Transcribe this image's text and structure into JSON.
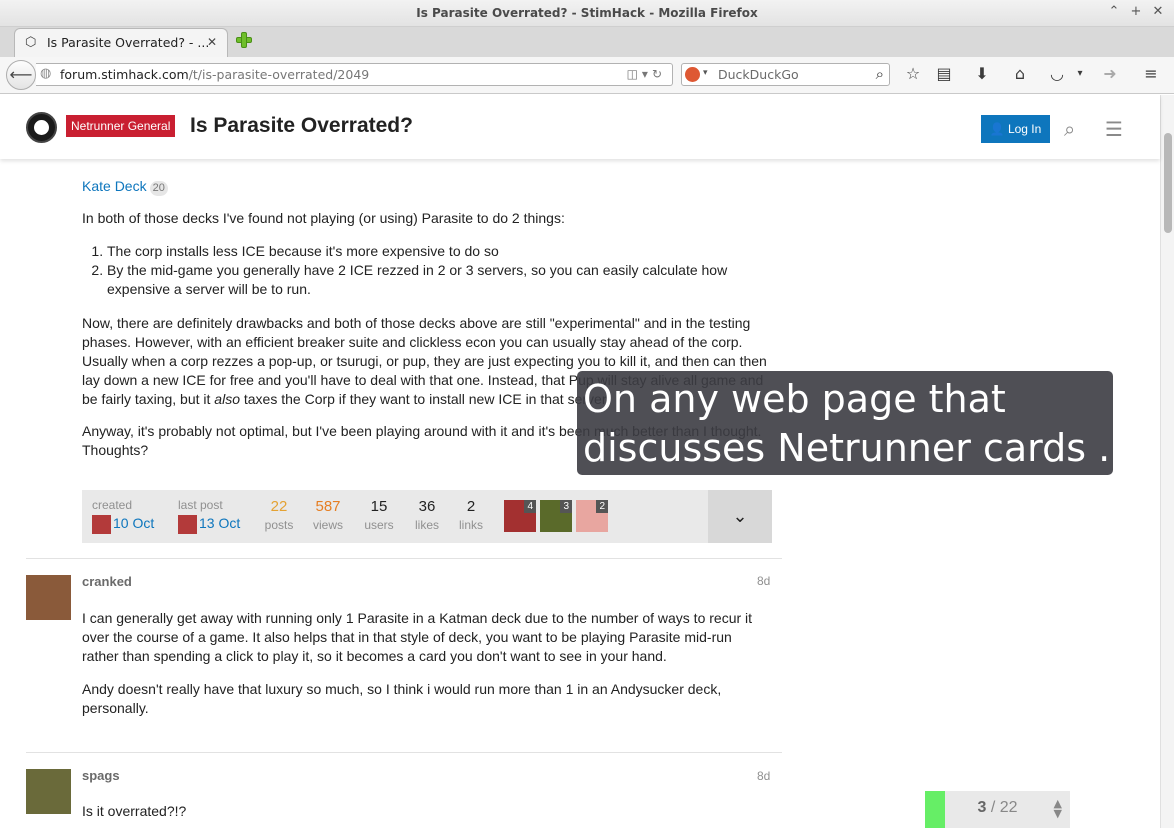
{
  "window": {
    "title": "Is Parasite Overrated? - StimHack - Mozilla Firefox"
  },
  "tab": {
    "label": "Is Parasite Overrated? - ..."
  },
  "urlbar": {
    "host": "forum.stimhack.com",
    "path": "/t/is-parasite-overrated/2049"
  },
  "search": {
    "placeholder": "DuckDuckGo"
  },
  "header": {
    "category": "Netrunner General",
    "topic_title": "Is Parasite Overrated?",
    "login_label": "Log In"
  },
  "post1": {
    "link_text": "Kate Deck",
    "link_count": "20",
    "intro": "In both of those decks I've found not playing (or using) Parasite to do 2 things:",
    "list": [
      "The corp installs less ICE because it's more expensive to do so",
      "By the mid-game you generally have 2 ICE rezzed in 2 or 3 servers, so you can easily calculate how expensive a server will be to run."
    ],
    "para2_a": "Now, there are definitely drawbacks and both of those decks above are still \"experimental\" and in the testing phases. However, with an efficient breaker suite and clickless econ you can usually stay ahead of the corp. Usually when a corp rezzes a pop-up, or tsurugi, or pup, they are just expecting you to kill it, and then can then lay down a new ICE for free and you'll have to deal with that one. Instead, that Pup will stay alive all game and be fairly taxing, but it ",
    "para2_em": "also",
    "para2_b": " taxes the Corp if they want to install new ICE in that server.",
    "para3": "Anyway, it's probably not optimal, but I've been playing around with it and it's been much better than I thought. Thoughts?"
  },
  "summary": {
    "created_label": "created",
    "created_date": "10 Oct",
    "last_label": "last post",
    "last_date": "13 Oct",
    "posts": "22",
    "posts_label": "posts",
    "views": "587",
    "views_label": "views",
    "users": "15",
    "users_label": "users",
    "likes": "36",
    "likes_label": "likes",
    "links": "2",
    "links_label": "links",
    "participants": [
      "4",
      "3",
      "2"
    ]
  },
  "post2": {
    "username": "cranked",
    "age": "8d",
    "para1": "I can generally get away with running only 1 Parasite in a Katman deck due to the number of ways to recur it over the course of a game. It also helps that in that style of deck, you want to be playing Parasite mid-run rather than spending a click to play it, so it becomes a card you don't want to see in your hand.",
    "para2": "Andy doesn't really have that luxury so much, so I think i would run more than 1 in an Andysucker deck, personally."
  },
  "post3": {
    "username": "spags",
    "age": "8d",
    "para1": "Is it overrated?!?"
  },
  "overlay": {
    "line1": "On any web page that",
    "line2": "discusses Netrunner cards ..."
  },
  "progress": {
    "current": "3",
    "total": "22",
    "fraction": 0.136
  }
}
